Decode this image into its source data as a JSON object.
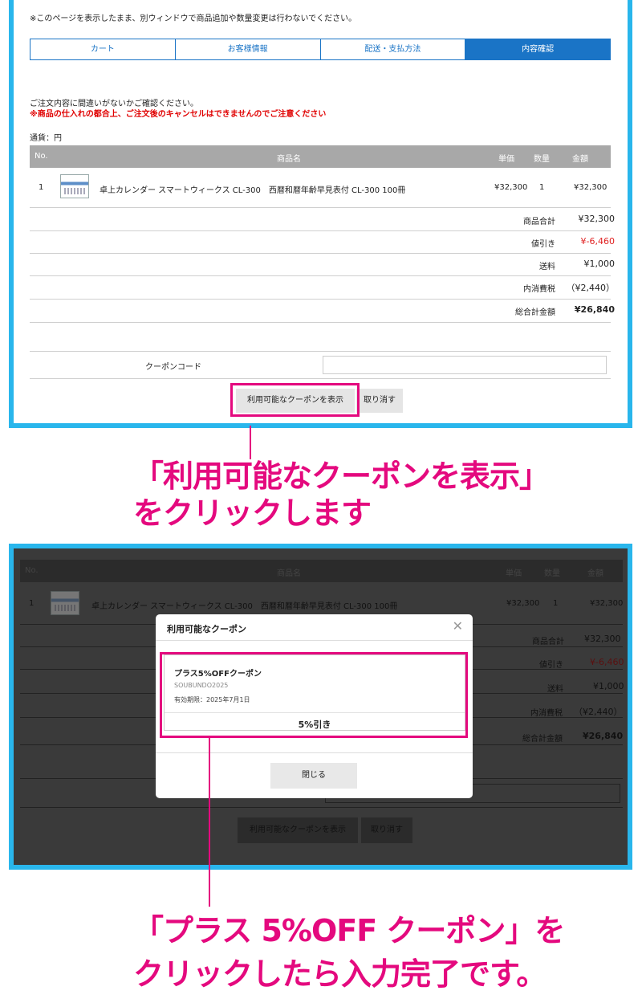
{
  "notice": "※このページを表示したまま、別ウィンドウで商品追加や数量変更は行わないでください。",
  "steps": [
    "カート",
    "お客様情報",
    "配送・支払方法",
    "内容確認"
  ],
  "confirm_text": "ご注文内容に間違いがないかご確認ください。",
  "warning_text": "※商品の仕入れの都合上、ご注文後のキャンセルはできませんのでご注意ください",
  "currency_note": "通貨：円",
  "table": {
    "headers": {
      "no": "No.",
      "name": "商品名",
      "unit_price": "単価",
      "qty": "数量",
      "amount": "金額"
    },
    "item": {
      "no": "1",
      "name": "卓上カレンダー スマートウィークス CL-300　西暦和暦年齢早見表付 CL-300 100冊",
      "unit_price": "¥32,300",
      "qty": "1",
      "amount": "¥32,300"
    }
  },
  "summary": {
    "subtotal_label": "商品合計",
    "subtotal": "¥32,300",
    "discount_label": "値引き",
    "discount": "¥-6,460",
    "shipping_label": "送料",
    "shipping": "¥1,000",
    "tax_label": "内消費税",
    "tax": "（¥2,440）",
    "total_label": "総合計金額",
    "total": "¥26,840"
  },
  "coupon": {
    "label": "クーポンコード",
    "input_value": "",
    "show_button": "利用可能なクーポンを表示",
    "cancel_button": "取り消す"
  },
  "callout1": [
    "「利用可能なクーポンを表示」",
    "をクリックします"
  ],
  "modal": {
    "title": "利用可能なクーポン",
    "coupon_name": "プラス5%OFFクーポン",
    "coupon_code": "SOUBUNDO2025",
    "expiry": "有効期限：2025年7月1日",
    "discount": "5%引き",
    "close_button": "閉じる"
  },
  "callout2": [
    "「プラス 5%OFF クーポン」を",
    "クリックしたら入力完了です。"
  ],
  "colors": {
    "accent_blue": "#1a74c6",
    "frame_cyan": "#29b6ec",
    "pink": "#e4097e",
    "discount_red": "#e02020",
    "warning_red": "#e00000"
  }
}
